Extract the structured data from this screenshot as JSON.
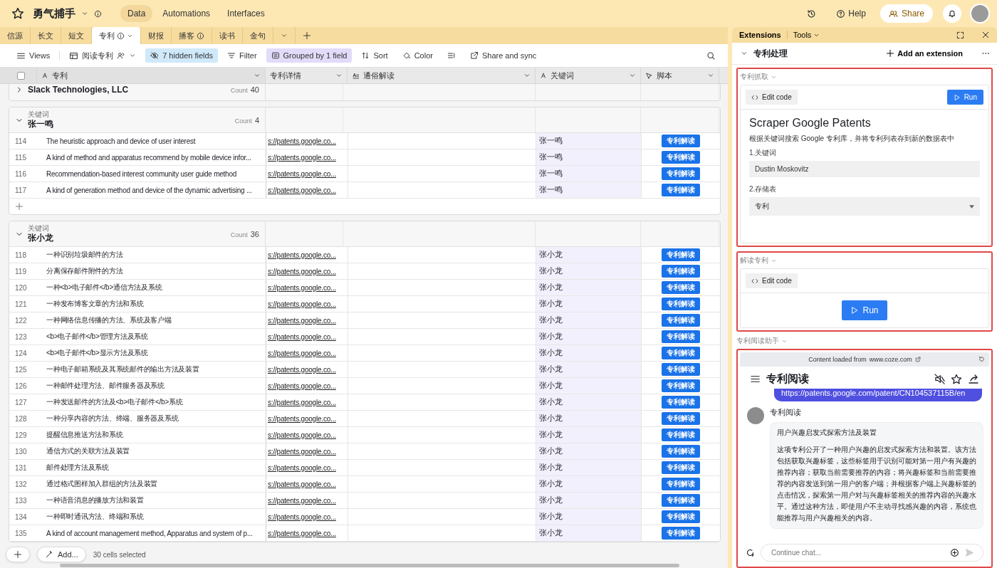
{
  "app": {
    "title": "勇气捕手",
    "nav": [
      {
        "label": "Data",
        "selected": true
      },
      {
        "label": "Automations",
        "selected": false
      },
      {
        "label": "Interfaces",
        "selected": false
      }
    ],
    "help": "Help",
    "share": "Share"
  },
  "table_tabs": [
    {
      "label": "信源",
      "selected": false,
      "info": false
    },
    {
      "label": "长文",
      "selected": false,
      "info": false
    },
    {
      "label": "短文",
      "selected": false,
      "info": false
    },
    {
      "label": "专利",
      "selected": true,
      "info": true
    },
    {
      "label": "财报",
      "selected": false,
      "info": false
    },
    {
      "label": "播客",
      "selected": false,
      "info": true
    },
    {
      "label": "读书",
      "selected": false,
      "info": false
    },
    {
      "label": "金句",
      "selected": false,
      "info": false
    }
  ],
  "toolbar": {
    "views": "Views",
    "view_name": "阅读专利",
    "buttons": [
      {
        "label": "7 hidden fields",
        "kind": "hidden"
      },
      {
        "label": "Filter",
        "kind": "filter"
      },
      {
        "label": "Grouped by 1 field",
        "kind": "group"
      },
      {
        "label": "Sort",
        "kind": "sort"
      },
      {
        "label": "Color",
        "kind": "color"
      },
      {
        "label": "Share and sync",
        "kind": "share"
      }
    ]
  },
  "table": {
    "columns": [
      "专利",
      "专利详情",
      "通俗解读",
      "关键词",
      "脚本"
    ],
    "select_all_checked": false,
    "groups": [
      {
        "name": "Slack Technologies, LLC",
        "count_label": "Count",
        "count": "40",
        "expanded": false
      },
      {
        "field": "关键词",
        "name": "张一鸣",
        "count_label": "Count",
        "count": "4",
        "expanded": true,
        "rows": [
          {
            "num": "114",
            "title": "The heuristic approach and device of user interest",
            "link": "s://patents.google.co...",
            "keyword": "张一鸣",
            "script": "专利解读"
          },
          {
            "num": "115",
            "title": "A kind of method and apparatus recommend by mobile device infor...",
            "link": "s://patents.google.co...",
            "keyword": "张一鸣",
            "script": "专利解读"
          },
          {
            "num": "116",
            "title": "Recommendation-based interest community user guide method",
            "link": "s://patents.google.co...",
            "keyword": "张一鸣",
            "script": "专利解读"
          },
          {
            "num": "117",
            "title": "A kind of generation method and device of the dynamic advertising ...",
            "link": "s://patents.google.co...",
            "keyword": "张一鸣",
            "script": "专利解读"
          }
        ]
      },
      {
        "field": "关键词",
        "name": "张小龙",
        "count_label": "Count",
        "count": "36",
        "expanded": true,
        "rows": [
          {
            "num": "118",
            "title": "一种识别垃圾邮件的方法",
            "link": "s://patents.google.co...",
            "keyword": "张小龙",
            "script": "专利解读"
          },
          {
            "num": "119",
            "title": "分离保存邮件附件的方法",
            "link": "s://patents.google.co...",
            "keyword": "张小龙",
            "script": "专利解读"
          },
          {
            "num": "120",
            "title": "一种<b>电子邮件</b>通信方法及系统",
            "link": "s://patents.google.co...",
            "keyword": "张小龙",
            "script": "专利解读"
          },
          {
            "num": "121",
            "title": "一种发布博客文章的方法和系统",
            "link": "s://patents.google.co...",
            "keyword": "张小龙",
            "script": "专利解读"
          },
          {
            "num": "122",
            "title": "一种网络信息传播的方法、系统及客户端",
            "link": "s://patents.google.co...",
            "keyword": "张小龙",
            "script": "专利解读"
          },
          {
            "num": "123",
            "title": "<b>电子邮件</b>管理方法及系统",
            "link": "s://patents.google.co...",
            "keyword": "张小龙",
            "script": "专利解读"
          },
          {
            "num": "124",
            "title": "<b>电子邮件</b>显示方法及系统",
            "link": "s://patents.google.co...",
            "keyword": "张小龙",
            "script": "专利解读"
          },
          {
            "num": "125",
            "title": "一种电子邮箱系统及其系统邮件的输出方法及装置",
            "link": "s://patents.google.co...",
            "keyword": "张小龙",
            "script": "专利解读"
          },
          {
            "num": "126",
            "title": "一种邮件处理方法、邮件服务器及系统",
            "link": "s://patents.google.co...",
            "keyword": "张小龙",
            "script": "专利解读"
          },
          {
            "num": "127",
            "title": "一种发送邮件的方法及<b>电子邮件</b>系统",
            "link": "s://patents.google.co...",
            "keyword": "张小龙",
            "script": "专利解读"
          },
          {
            "num": "128",
            "title": "一种分享内容的方法、终端、服务器及系统",
            "link": "s://patents.google.co...",
            "keyword": "张小龙",
            "script": "专利解读"
          },
          {
            "num": "129",
            "title": "提醒信息推送方法和系统",
            "link": "s://patents.google.co...",
            "keyword": "张小龙",
            "script": "专利解读"
          },
          {
            "num": "130",
            "title": "通信方式的关联方法及装置",
            "link": "s://patents.google.co...",
            "keyword": "张小龙",
            "script": "专利解读"
          },
          {
            "num": "131",
            "title": "邮件处理方法及系统",
            "link": "s://patents.google.co...",
            "keyword": "张小龙",
            "script": "专利解读"
          },
          {
            "num": "132",
            "title": "通过格式图样加入群组的方法及装置",
            "link": "s://patents.google.co...",
            "keyword": "张小龙",
            "script": "专利解读"
          },
          {
            "num": "133",
            "title": "一种语音消息的播放方法和装置",
            "link": "s://patents.google.co...",
            "keyword": "张小龙",
            "script": "专利解读"
          },
          {
            "num": "134",
            "title": "一种即时通讯方法、终端和系统",
            "link": "s://patents.google.co...",
            "keyword": "张小龙",
            "script": "专利解读"
          },
          {
            "num": "135",
            "title": "A kind of account management method, Apparatus and system of p...",
            "link": "s://patents.google.co...",
            "keyword": "张小龙",
            "script": "专利解读"
          }
        ]
      }
    ]
  },
  "status_bar": {
    "add": "Add...",
    "selection": "30 cells selected"
  },
  "extensions": {
    "tabs": [
      "Extensions",
      "Tools"
    ],
    "section": "专利处理",
    "add": "Add an extension",
    "items": [
      {
        "kind": "form",
        "name": "专利抓取",
        "edit": "Edit code",
        "run": "Run",
        "title": "Scraper Google Patents",
        "description": "根据关键词搜索 Google 专利库，并将专利列表存到新的数据表中",
        "fields": [
          {
            "label": "1.关键词",
            "value": "Dustin Moskovitz",
            "kind": "text"
          },
          {
            "label": "2.存储表",
            "value": "专利",
            "kind": "select"
          }
        ]
      },
      {
        "kind": "button",
        "name": "解读专利",
        "edit": "Edit code",
        "run": "Run"
      },
      {
        "kind": "chat",
        "name": "专利阅读助手",
        "source_label": "Content loaded from",
        "source": "www.coze.com",
        "title": "专利阅读",
        "user_message": "https://patents.google.com/patent/CN104537115B/en",
        "bot_name": "专利阅读",
        "reply": [
          "用户兴趣启发式探索方法及装置",
          "这项专利公开了一种用户兴趣的启发式探索方法和装置。该方法包括获取兴趣标签，这些标签用于识别可能对第一用户有兴趣的推荐内容；获取当前需要推荐的内容；将兴趣标签和当前需要推荐的内容发送到第一用户的客户端；并根据客户端上兴趣标签的点击情况，探索第一用户对与兴趣标签相关的推荐内容的兴趣水平。通过这种方法，即使用户不主动寻找感兴趣的内容，系统也能推荐与用户兴趣相关的内容。"
        ],
        "placeholder": "Continue chat..."
      }
    ]
  }
}
